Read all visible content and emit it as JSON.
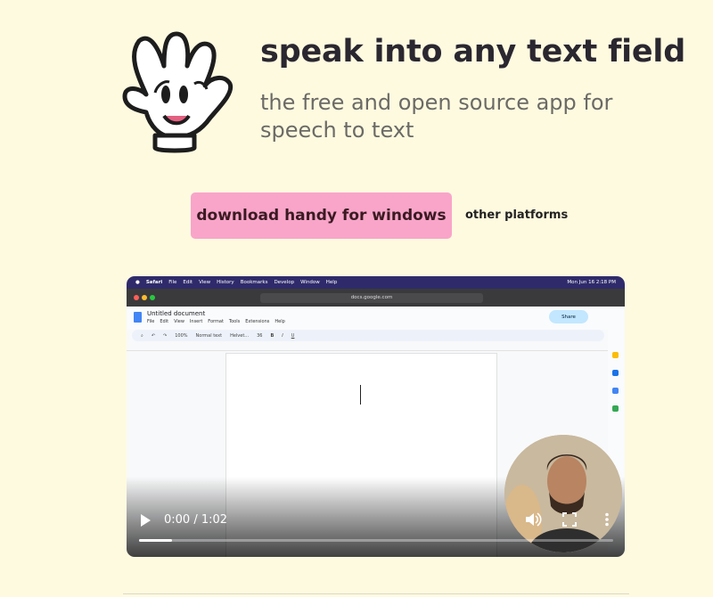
{
  "hero": {
    "title": "speak into any text field",
    "subtitle": "the free and open source app for speech to text"
  },
  "actions": {
    "download_label": "download handy for windows",
    "other_label": "other platforms"
  },
  "video": {
    "mac_menu": [
      "Safari",
      "File",
      "Edit",
      "View",
      "History",
      "Bookmarks",
      "Develop",
      "Window",
      "Help"
    ],
    "clock": "Mon Jun 16  2:18 PM",
    "url": "docs.google.com",
    "doc_title": "Untitled document",
    "doc_menu": [
      "File",
      "Edit",
      "View",
      "Insert",
      "Format",
      "Tools",
      "Extensions",
      "Help"
    ],
    "share_label": "Share",
    "toolbar": [
      "100%",
      "Normal text",
      "Helvet...",
      "36"
    ],
    "time": "0:00 / 1:02",
    "progress": 0.07
  },
  "colors": {
    "background": "#fefae0",
    "button": "#f8a5c9",
    "mac_menu": "#2f2b6b"
  }
}
